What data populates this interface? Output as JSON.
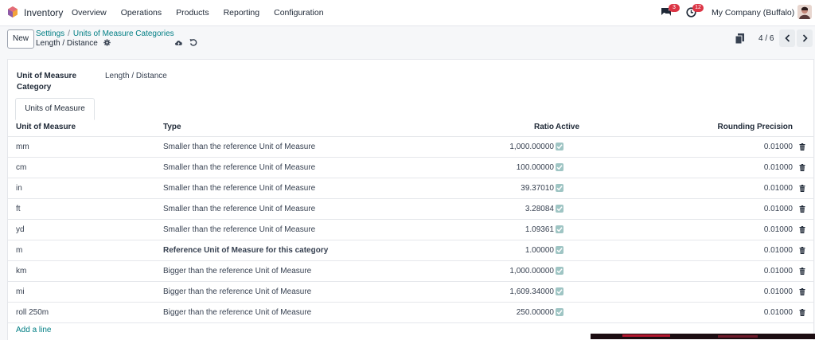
{
  "navbar": {
    "app_name": "Inventory",
    "menu": [
      "Overview",
      "Operations",
      "Products",
      "Reporting",
      "Configuration"
    ],
    "messages_count": "3",
    "activities_count": "12",
    "company": "My Company (Buffalo)"
  },
  "control": {
    "new_label": "New",
    "breadcrumb": [
      "Settings",
      "Units of Measure Categories"
    ],
    "record_name": "Length / Distance",
    "pager": "4 / 6"
  },
  "form": {
    "category_label": "Unit of Measure Category",
    "category_value": "Length / Distance",
    "tab_label": "Units of Measure",
    "columns": [
      "Unit of Measure",
      "Type",
      "Ratio",
      "Active",
      "Rounding Precision"
    ],
    "rows": [
      {
        "name": "mm",
        "type": "Smaller than the reference Unit of Measure",
        "ratio": "1,000.00000",
        "active": true,
        "rounding": "0.01000"
      },
      {
        "name": "cm",
        "type": "Smaller than the reference Unit of Measure",
        "ratio": "100.00000",
        "active": true,
        "rounding": "0.01000"
      },
      {
        "name": "in",
        "type": "Smaller than the reference Unit of Measure",
        "ratio": "39.37010",
        "active": true,
        "rounding": "0.01000"
      },
      {
        "name": "ft",
        "type": "Smaller than the reference Unit of Measure",
        "ratio": "3.28084",
        "active": true,
        "rounding": "0.01000"
      },
      {
        "name": "yd",
        "type": "Smaller than the reference Unit of Measure",
        "ratio": "1.09361",
        "active": true,
        "rounding": "0.01000"
      },
      {
        "name": "m",
        "type": "Reference Unit of Measure for this category",
        "ratio": "1.00000",
        "active": true,
        "rounding": "0.01000",
        "reference": true
      },
      {
        "name": "km",
        "type": "Bigger than the reference Unit of Measure",
        "ratio": "1,000.00000",
        "active": true,
        "rounding": "0.01000"
      },
      {
        "name": "mi",
        "type": "Bigger than the reference Unit of Measure",
        "ratio": "1,609.34000",
        "active": true,
        "rounding": "0.01000"
      },
      {
        "name": "roll 250m",
        "type": "Bigger than the reference Unit of Measure",
        "ratio": "250.00000",
        "active": true,
        "rounding": "0.01000"
      }
    ],
    "add_line": "Add a line"
  },
  "colors": {
    "accent": "#017e84",
    "badge": "#dc3545",
    "checkbox": "#9fc5c4"
  },
  "icons": [
    "app-logo-icon",
    "chat-icon",
    "clock-icon",
    "gear-icon",
    "cloud-upload-icon",
    "undo-icon",
    "archive-icon",
    "chevron-left-icon",
    "chevron-right-icon",
    "trash-icon"
  ]
}
